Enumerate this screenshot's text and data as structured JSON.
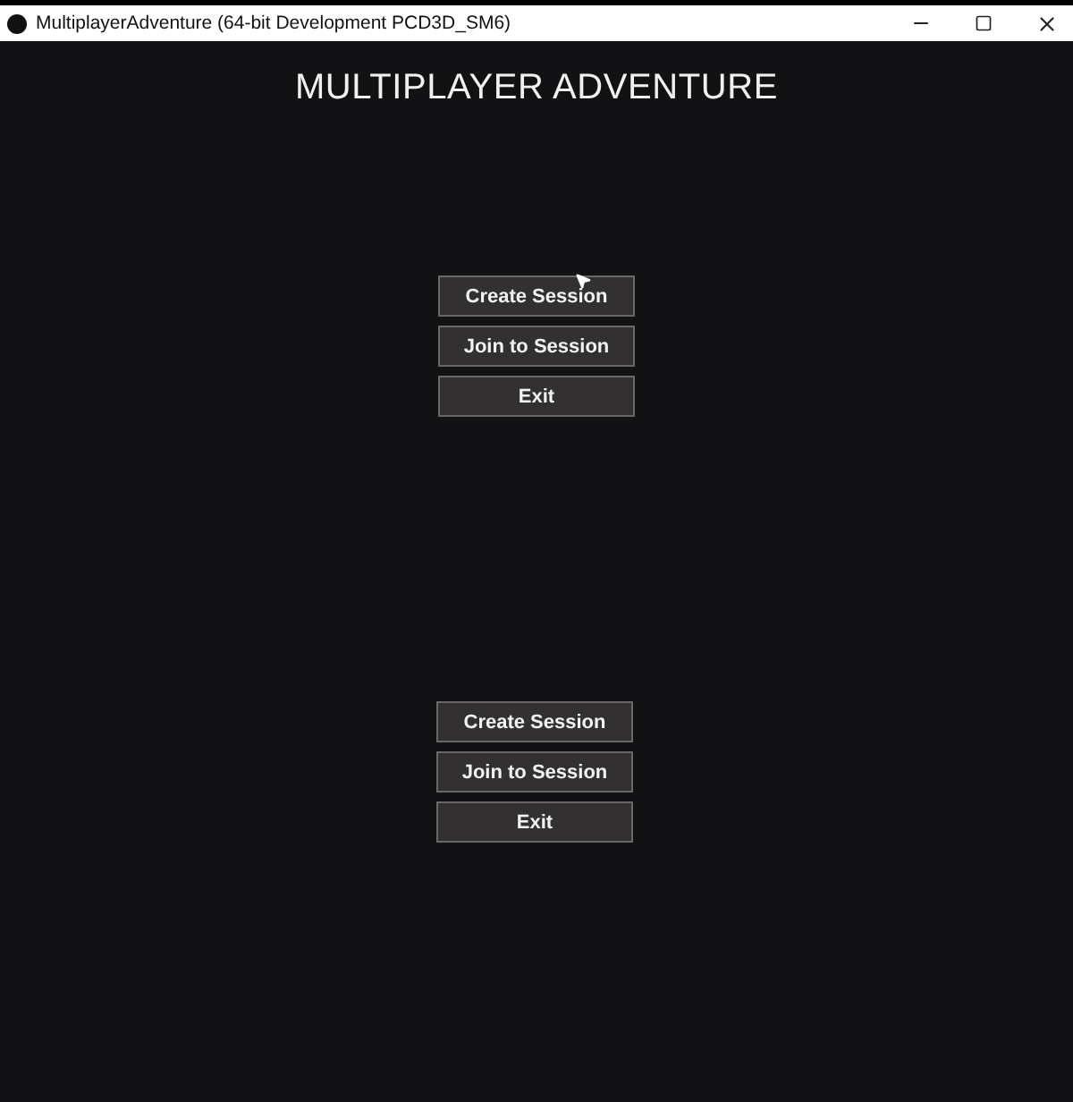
{
  "window": {
    "title": "MultiplayerAdventure (64-bit Development PCD3D_SM6)"
  },
  "heading": "MULTIPLAYER ADVENTURE",
  "menus": [
    {
      "buttons": [
        "Create Session",
        "Join to Session",
        "Exit"
      ]
    },
    {
      "buttons": [
        "Create Session",
        "Join to Session",
        "Exit"
      ]
    }
  ]
}
